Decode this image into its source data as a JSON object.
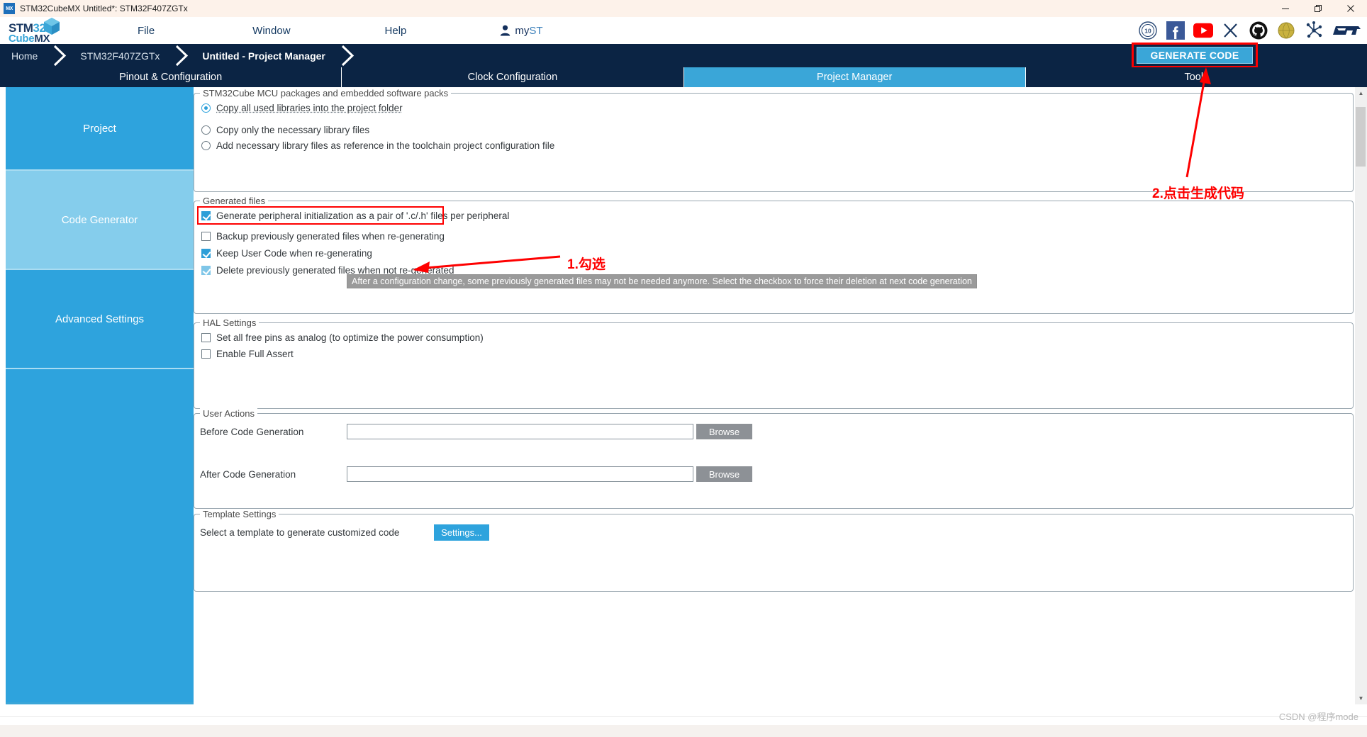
{
  "window": {
    "app_icon": "MX",
    "title": "STM32CubeMX Untitled*: STM32F407ZGTx",
    "minimize_label": "minimize",
    "restore_label": "restore",
    "close_label": "close"
  },
  "logo": {
    "line1_a": "STM",
    "line1_b": "32",
    "line2_a": "Cube",
    "line2_b": "MX"
  },
  "menu": {
    "items": [
      {
        "label": "File"
      },
      {
        "label": "Window"
      },
      {
        "label": "Help"
      }
    ],
    "account": {
      "prefix": "my",
      "suffix": "ST"
    }
  },
  "social": [
    {
      "name": "anniversary-10-years-icon",
      "label": "10"
    },
    {
      "name": "facebook-icon",
      "label": "f"
    },
    {
      "name": "youtube-icon",
      "label": "▶"
    },
    {
      "name": "x-twitter-icon",
      "label": "X"
    },
    {
      "name": "github-icon",
      "label": "GitHub"
    },
    {
      "name": "wiki-globe-icon",
      "label": "Wiki"
    },
    {
      "name": "community-network-icon",
      "label": "Community"
    },
    {
      "name": "st-logo-icon",
      "label": "ST"
    }
  ],
  "breadcrumb": {
    "items": [
      {
        "label": "Home",
        "bold": false
      },
      {
        "label": "STM32F407ZGTx",
        "bold": false
      },
      {
        "label": "Untitled - Project Manager",
        "bold": true
      }
    ],
    "generate_code_label": "GENERATE CODE"
  },
  "tabs": [
    {
      "label": "Pinout & Configuration",
      "active": false
    },
    {
      "label": "Clock Configuration",
      "active": false
    },
    {
      "label": "Project Manager",
      "active": true
    },
    {
      "label": "Tools",
      "active": false
    }
  ],
  "sidebar": {
    "items": [
      {
        "label": "Project",
        "active": false
      },
      {
        "label": "Code Generator",
        "active": true
      },
      {
        "label": "Advanced Settings",
        "active": false
      },
      {
        "label": "",
        "active": false
      }
    ]
  },
  "groups": {
    "packages": {
      "title": "STM32Cube MCU packages and embedded software packs",
      "options": [
        {
          "label": "Copy all used libraries into the project folder",
          "selected": true
        },
        {
          "label": "Copy only the necessary library files",
          "selected": false
        },
        {
          "label": "Add necessary library files as reference in the toolchain project configuration file",
          "selected": false
        }
      ]
    },
    "generated_files": {
      "title": "Generated files",
      "checkboxes": [
        {
          "label": "Generate peripheral initialization as a pair of '.c/.h' files per peripheral",
          "checked": true,
          "highlighted": true,
          "faded": false
        },
        {
          "label": "Backup previously generated files when re-generating",
          "checked": false,
          "highlighted": false,
          "faded": false
        },
        {
          "label": "Keep User Code when re-generating",
          "checked": true,
          "highlighted": false,
          "faded": false
        },
        {
          "label": "Delete previously generated files when not re-generated",
          "checked": true,
          "highlighted": false,
          "faded": true
        }
      ],
      "tooltip": "After a configuration change, some previously generated files may not be needed anymore. Select the checkbox to force their deletion at next code generation"
    },
    "hal_settings": {
      "title": "HAL Settings",
      "checkboxes": [
        {
          "label": "Set all free pins as analog (to optimize the power consumption)",
          "checked": false
        },
        {
          "label": "Enable Full Assert",
          "checked": false
        }
      ]
    },
    "user_actions": {
      "title": "User Actions",
      "rows": [
        {
          "label": "Before Code Generation",
          "value": "",
          "button": "Browse"
        },
        {
          "label": "After Code Generation",
          "value": "",
          "button": "Browse"
        }
      ]
    },
    "template_settings": {
      "title": "Template Settings",
      "label": "Select a template to generate customized code",
      "button": "Settings..."
    }
  },
  "annotations": [
    {
      "name": "annotation-check-the-box",
      "text": "1.勾选"
    },
    {
      "name": "annotation-click-generate-code",
      "text": "2.点击生成代码"
    }
  ],
  "watermark": "CSDN @程序mode",
  "colors": {
    "accent_blue": "#2ea3dd",
    "dark_navy": "#0b2444",
    "annotation_red": "#fe0000",
    "tooltip_gray": "#9a9a9a"
  }
}
